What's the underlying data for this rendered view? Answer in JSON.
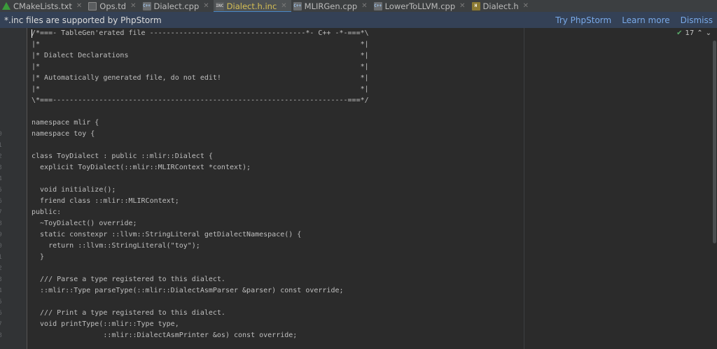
{
  "tabs": [
    {
      "label": "CMakeLists.txt",
      "icon": "cmake-icon",
      "active": false
    },
    {
      "label": "Ops.td",
      "icon": "td-file-icon",
      "active": false
    },
    {
      "label": "Dialect.cpp",
      "icon": "cpp-file-icon",
      "active": false
    },
    {
      "label": "Dialect.h.inc",
      "icon": "inc-file-icon",
      "active": true
    },
    {
      "label": "MLIRGen.cpp",
      "icon": "cpp-file-icon",
      "active": false
    },
    {
      "label": "LowerToLLVM.cpp",
      "icon": "cpp-file-icon",
      "active": false
    },
    {
      "label": "Dialect.h",
      "icon": "h-file-icon",
      "active": false
    }
  ],
  "banner": {
    "message": "*.inc files are supported by PhpStorm",
    "try_label": "Try PhpStorm",
    "learn_label": "Learn more",
    "dismiss_label": "Dismiss"
  },
  "inspection": {
    "count": "17"
  },
  "colors": {
    "active_tab_text": "#d6bf55",
    "banner_bg": "#344156",
    "link": "#79a9e8",
    "editor_bg": "#2b2b2b"
  },
  "lines": [
    {
      "n": "1",
      "text": "/*===- TableGen'erated file -------------------------------------*- C++ -*-===*\\"
    },
    {
      "n": "2",
      "text": "|*                                                                            *|"
    },
    {
      "n": "3",
      "text": "|* Dialect Declarations                                                       *|"
    },
    {
      "n": "4",
      "text": "|*                                                                            *|"
    },
    {
      "n": "5",
      "text": "|* Automatically generated file, do not edit!                                 *|"
    },
    {
      "n": "6",
      "text": "|*                                                                            *|"
    },
    {
      "n": "7",
      "text": "\\*===----------------------------------------------------------------------===*/"
    },
    {
      "n": "8",
      "text": ""
    },
    {
      "n": "9",
      "text": "namespace mlir {"
    },
    {
      "n": "10",
      "text": "namespace toy {"
    },
    {
      "n": "11",
      "text": ""
    },
    {
      "n": "12",
      "text": "class ToyDialect : public ::mlir::Dialect {"
    },
    {
      "n": "13",
      "text": "  explicit ToyDialect(::mlir::MLIRContext *context);"
    },
    {
      "n": "14",
      "text": ""
    },
    {
      "n": "15",
      "text": "  void initialize();"
    },
    {
      "n": "16",
      "text": "  friend class ::mlir::MLIRContext;"
    },
    {
      "n": "17",
      "text": "public:"
    },
    {
      "n": "18",
      "text": "  ~ToyDialect() override;"
    },
    {
      "n": "19",
      "text": "  static constexpr ::llvm::StringLiteral getDialectNamespace() {"
    },
    {
      "n": "20",
      "text": "    return ::llvm::StringLiteral(\"toy\");"
    },
    {
      "n": "21",
      "text": "  }"
    },
    {
      "n": "22",
      "text": ""
    },
    {
      "n": "23",
      "text": "  /// Parse a type registered to this dialect."
    },
    {
      "n": "24",
      "text": "  ::mlir::Type parseType(::mlir::DialectAsmParser &parser) const override;"
    },
    {
      "n": "25",
      "text": ""
    },
    {
      "n": "26",
      "text": "  /// Print a type registered to this dialect."
    },
    {
      "n": "27",
      "text": "  void printType(::mlir::Type type,"
    },
    {
      "n": "28",
      "text": "                 ::mlir::DialectAsmPrinter &os) const override;"
    }
  ]
}
